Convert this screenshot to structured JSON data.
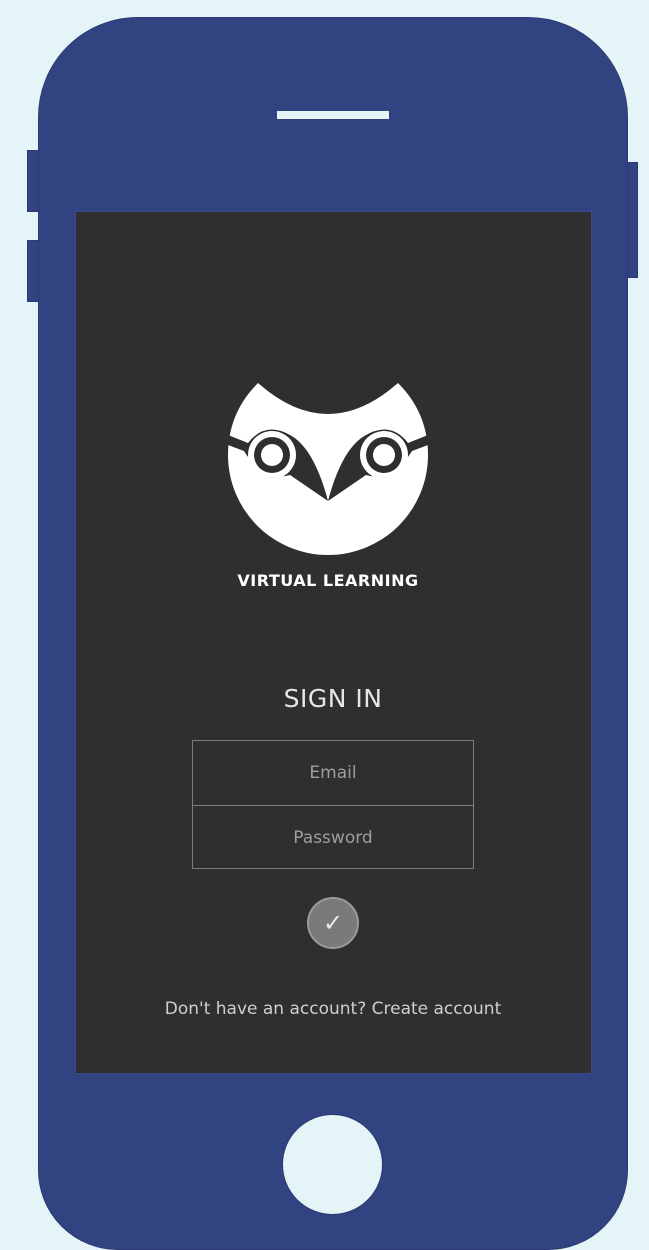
{
  "brand": {
    "name": "VIRTUAL LEARNING",
    "logo_icon": "owl-logo-icon"
  },
  "sign_in": {
    "title": "SIGN IN",
    "email_placeholder": "Email",
    "email_value": "",
    "password_placeholder": "Password",
    "password_value": "",
    "submit_icon": "checkmark-icon",
    "submit_glyph": "✓"
  },
  "footer": {
    "prompt": "Don't have an account?",
    "link_label": "Create account"
  },
  "colors": {
    "background": "#e5f4f6",
    "device": "#324382",
    "screen": "#2f2f2f",
    "text_primary": "#ffffff",
    "text_muted": "#9e9e9e",
    "button": "#7a7a7a"
  }
}
